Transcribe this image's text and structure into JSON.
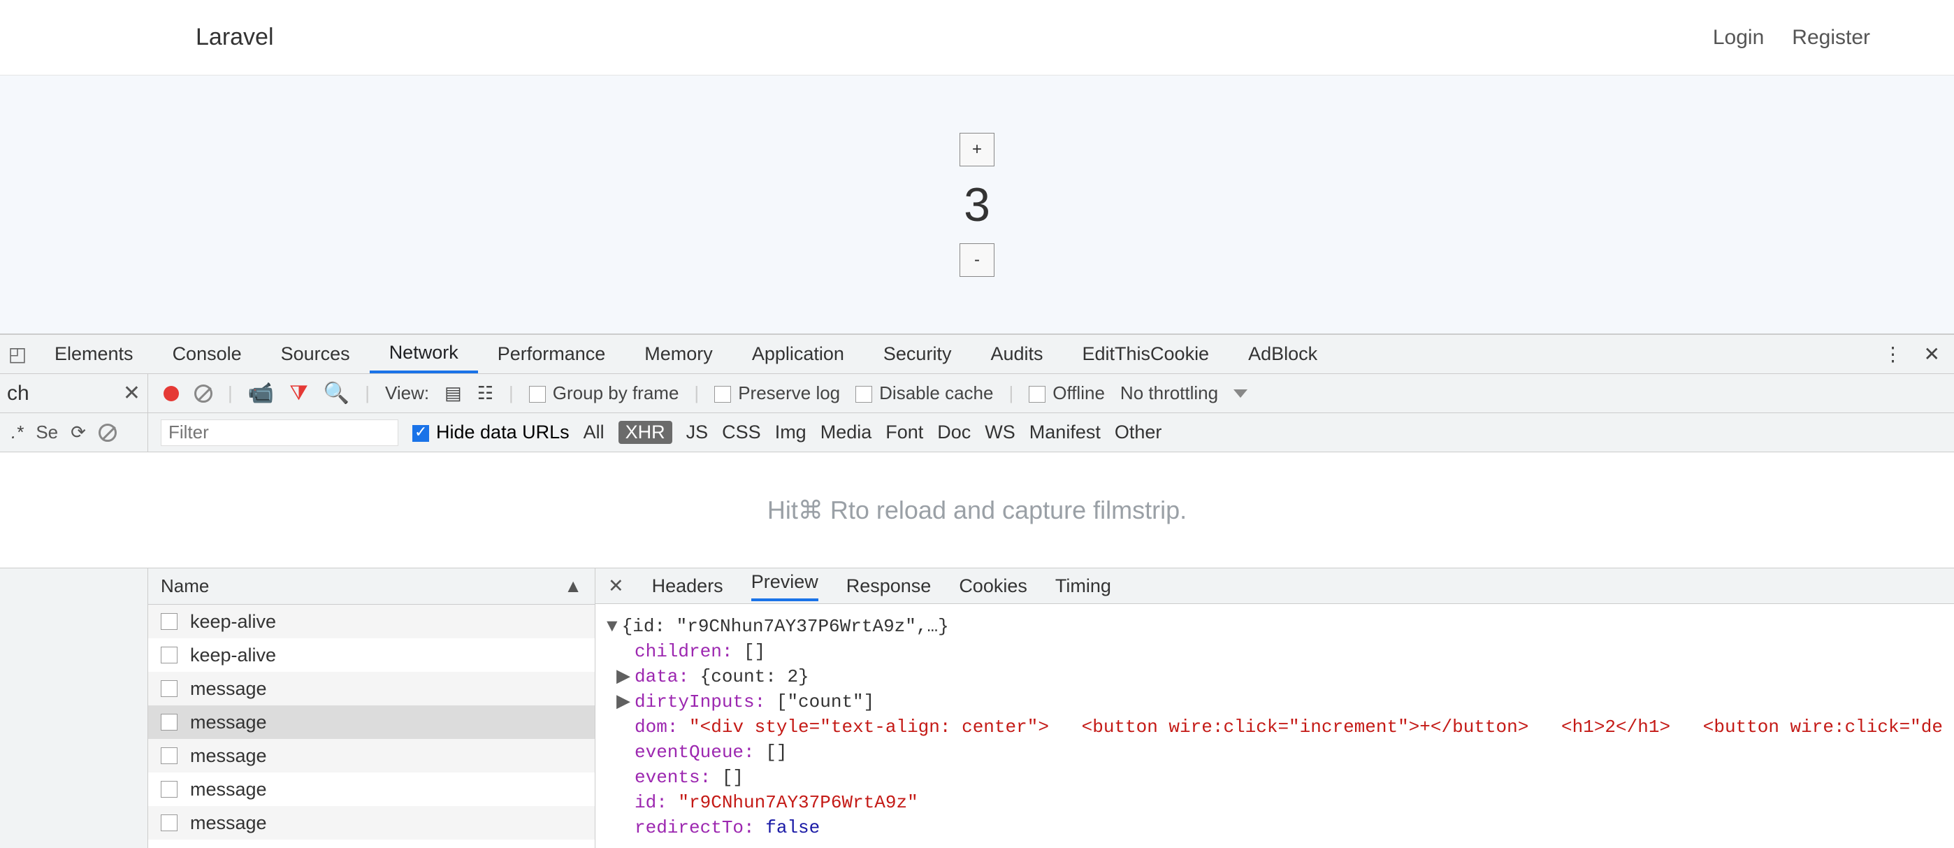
{
  "header": {
    "brand": "Laravel",
    "login": "Login",
    "register": "Register"
  },
  "counter": {
    "plus": "+",
    "value": "3",
    "minus": "-"
  },
  "devtools": {
    "tabs": {
      "elements": "Elements",
      "console": "Console",
      "sources": "Sources",
      "network": "Network",
      "performance": "Performance",
      "memory": "Memory",
      "application": "Application",
      "security": "Security",
      "audits": "Audits",
      "editthiscookie": "EditThisCookie",
      "adblock": "AdBlock"
    },
    "search_panel_label": "ch",
    "toolbar": {
      "view_label": "View:",
      "group_by_frame": "Group by frame",
      "preserve_log": "Preserve log",
      "disable_cache": "Disable cache",
      "offline": "Offline",
      "throttling": "No throttling"
    },
    "filter_left": {
      "regex": ".*",
      "search_placeholder": "Se"
    },
    "filter": {
      "placeholder": "Filter",
      "hide_data_urls": "Hide data URLs",
      "types": {
        "all": "All",
        "xhr": "XHR",
        "js": "JS",
        "css": "CSS",
        "img": "Img",
        "media": "Media",
        "font": "Font",
        "doc": "Doc",
        "ws": "WS",
        "manifest": "Manifest",
        "other": "Other"
      }
    },
    "filmstrip_prefix": "Hit ",
    "filmstrip_keys": "⌘ R",
    "filmstrip_suffix": " to reload and capture filmstrip.",
    "requests": {
      "header": "Name",
      "rows": [
        "keep-alive",
        "keep-alive",
        "message",
        "message",
        "message",
        "message",
        "message"
      ],
      "selected_index": 3
    },
    "detail_tabs": {
      "headers": "Headers",
      "preview": "Preview",
      "response": "Response",
      "cookies": "Cookies",
      "timing": "Timing"
    },
    "preview": {
      "top": "{id: \"r9CNhun7AY37P6WrtA9z\",…}",
      "children_k": "children:",
      "children_v": "[]",
      "data_k": "data:",
      "data_v": "{count: 2}",
      "dirty_k": "dirtyInputs:",
      "dirty_v": "[\"count\"]",
      "dom_k": "dom:",
      "dom_v1": "\"<div style=\"text-align: center\">",
      "dom_v2": "<button wire:click=\"increment\">+</button>",
      "dom_v3": "<h1>2</h1>",
      "dom_v4": "<button wire:click=\"de",
      "evq_k": "eventQueue:",
      "evq_v": "[]",
      "events_k": "events:",
      "events_v": "[]",
      "id_k": "id:",
      "id_v": "\"r9CNhun7AY37P6WrtA9z\"",
      "redir_k": "redirectTo:",
      "redir_v": "false"
    }
  }
}
